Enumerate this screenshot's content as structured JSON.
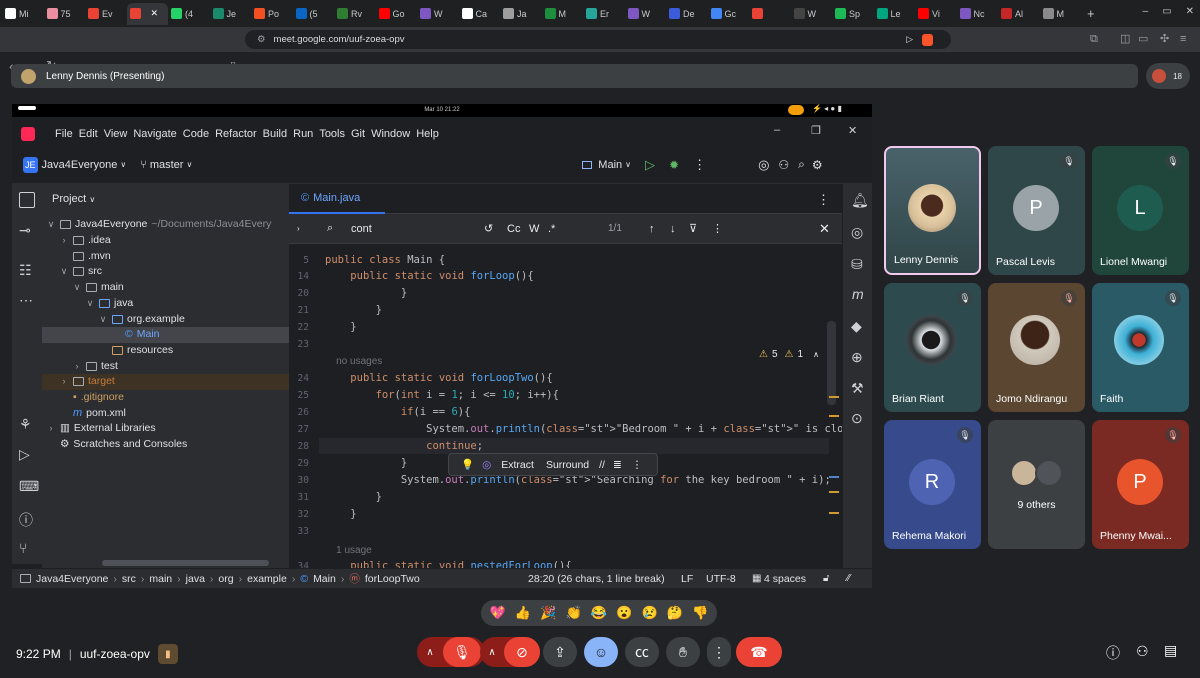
{
  "browser": {
    "tabs": [
      {
        "label": "Mi",
        "color": "#ffffff"
      },
      {
        "label": "75",
        "color": "#ea8fa0"
      },
      {
        "label": "Ev",
        "color": "#ea4335"
      },
      {
        "label": "",
        "color": "#ea4335",
        "active": true,
        "close": "✕"
      },
      {
        "label": "(4",
        "color": "#25d366"
      },
      {
        "label": "Je",
        "color": "#1a8a6a"
      },
      {
        "label": "Po",
        "color": "#f25022"
      },
      {
        "label": "(5",
        "color": "#0a66c2"
      },
      {
        "label": "Rv",
        "color": "#2e7d32"
      },
      {
        "label": "Go",
        "color": "#ff0000"
      },
      {
        "label": "W",
        "color": "#7e57c2"
      },
      {
        "label": "Ca",
        "color": "#ffffff"
      },
      {
        "label": "Ja",
        "color": "#9e9e9e"
      },
      {
        "label": "M",
        "color": "#1e8e3e"
      },
      {
        "label": "Er",
        "color": "#26a69a"
      },
      {
        "label": "W",
        "color": "#7e57c2"
      },
      {
        "label": "De",
        "color": "#3b5bdb"
      },
      {
        "label": "Gc",
        "color": "#4285f4"
      },
      {
        "label": "",
        "color": "#ea4335"
      },
      {
        "label": "W",
        "color": "#444444"
      },
      {
        "label": "Sp",
        "color": "#1db954"
      },
      {
        "label": "Le",
        "color": "#00a67e"
      },
      {
        "label": "Vi",
        "color": "#ff0000"
      },
      {
        "label": "Nc",
        "color": "#7e57c2"
      },
      {
        "label": "Al",
        "color": "#c62828"
      },
      {
        "label": "M",
        "color": "#8a8a8a"
      }
    ],
    "new_tab": "+",
    "url": "meet.google.com/uuf-zoea-opv"
  },
  "presenting": {
    "label": "Lenny Dennis (Presenting)",
    "participants": "18"
  },
  "ide": {
    "clock": "Mar 10  21:22",
    "menu": [
      "File",
      "Edit",
      "View",
      "Navigate",
      "Code",
      "Refactor",
      "Build",
      "Run",
      "Tools",
      "Git",
      "Window",
      "Help"
    ],
    "project_badge": "JE",
    "project": "Java4Everyone",
    "branch": "master",
    "run_config": "Main",
    "panel_title": "Project",
    "tree": [
      {
        "label": "Java4Everyone",
        "suffix": "~/Documents/Java4Every",
        "depth": 0,
        "arrow": "∨"
      },
      {
        "label": ".idea",
        "depth": 1,
        "arrow": "›"
      },
      {
        "label": ".mvn",
        "depth": 1,
        "arrow": ""
      },
      {
        "label": "src",
        "depth": 1,
        "arrow": "∨"
      },
      {
        "label": "main",
        "depth": 2,
        "arrow": "∨"
      },
      {
        "label": "java",
        "depth": 3,
        "arrow": "∨"
      },
      {
        "label": "org.example",
        "depth": 4,
        "arrow": "∨"
      },
      {
        "label": "Main",
        "depth": 5,
        "arrow": "",
        "selected": true
      },
      {
        "label": "resources",
        "depth": 4,
        "arrow": ""
      },
      {
        "label": "test",
        "depth": 2,
        "arrow": "›"
      },
      {
        "label": "target",
        "depth": 1,
        "arrow": "›",
        "excluded": true
      },
      {
        "label": ".gitignore",
        "depth": 1,
        "arrow": "",
        "orange": true
      },
      {
        "label": "pom.xml",
        "depth": 1,
        "arrow": ""
      },
      {
        "label": "External Libraries",
        "depth": 0,
        "arrow": "›"
      },
      {
        "label": "Scratches and Consoles",
        "depth": 0,
        "arrow": ""
      }
    ],
    "file_tab": "Main.java",
    "find": {
      "query": "cont",
      "case": "Cc",
      "word": "W",
      "regex": ".*",
      "count": "1/1"
    },
    "warnings": "5",
    "weak_warnings": "1",
    "code": [
      {
        "n": "5",
        "t": "public class Main {"
      },
      {
        "n": "14",
        "t": "    public static void forLoop(){"
      },
      {
        "n": "20",
        "t": "            }"
      },
      {
        "n": "21",
        "t": "        }"
      },
      {
        "n": "22",
        "t": "    }"
      },
      {
        "n": "23",
        "t": ""
      },
      {
        "n": "",
        "t": "    no usages",
        "hint": true
      },
      {
        "n": "24",
        "t": "    public static void forLoopTwo(){"
      },
      {
        "n": "25",
        "t": "        for(int i = 1; i <= 10; i++){"
      },
      {
        "n": "26",
        "t": "            if(i == 6){"
      },
      {
        "n": "27",
        "t": "                System.out.println(\"Bedroom \" + i + \" is closed\");"
      },
      {
        "n": "28",
        "t": "                continue;",
        "current": true
      },
      {
        "n": "29",
        "t": "            }"
      },
      {
        "n": "30",
        "t": "            System.out.println(\"Searching for the key bedroom \" + i);"
      },
      {
        "n": "31",
        "t": "        }"
      },
      {
        "n": "32",
        "t": "    }"
      },
      {
        "n": "33",
        "t": ""
      },
      {
        "n": "",
        "t": "    1 usage",
        "hint": true
      },
      {
        "n": "34",
        "t": "    public static void nestedForLoop(){"
      }
    ],
    "popup": {
      "extract": "Extract",
      "surround": "Surround"
    },
    "breadcrumb": [
      "Java4Everyone",
      "src",
      "main",
      "java",
      "org",
      "example",
      "Main",
      "forLoopTwo"
    ],
    "status": {
      "position": "28:20 (26 chars, 1 line break)",
      "line_sep": "LF",
      "encoding": "UTF-8",
      "indent": "4 spaces"
    }
  },
  "participants": [
    {
      "name": "Lenny Dennis",
      "bg": "#3a5255",
      "speaking": true
    },
    {
      "name": "Pascal Levis",
      "initial": "P",
      "bg": "#30474a",
      "avatar_color": "#9aa3a8",
      "muted": true
    },
    {
      "name": "Lionel Mwangi",
      "initial": "L",
      "bg": "#20463c",
      "avatar_color": "#1e5c4f",
      "muted": true
    },
    {
      "name": "Brian Riant",
      "bg": "#2d4b4e",
      "muted": true
    },
    {
      "name": "Jomo Ndirangu",
      "bg": "#5b4631",
      "muted": true
    },
    {
      "name": "Faith",
      "bg": "#2a5a66",
      "muted": true
    },
    {
      "name": "Rehema Makori",
      "initial": "R",
      "bg": "#374a8c",
      "avatar_color": "#4f63b3",
      "muted": true
    },
    {
      "name": "9 others",
      "bg": "#3c4043"
    },
    {
      "name": "Phenny Mwai...",
      "initial": "P",
      "bg": "#7a2a22",
      "avatar_color": "#e8542c",
      "muted": true
    }
  ],
  "reactions": [
    "💖",
    "👍",
    "🎉",
    "👏",
    "😂",
    "😮",
    "😢",
    "🤔",
    "👎"
  ],
  "bottom": {
    "time": "9:22 PM",
    "meeting_code": "uuf-zoea-opv"
  }
}
